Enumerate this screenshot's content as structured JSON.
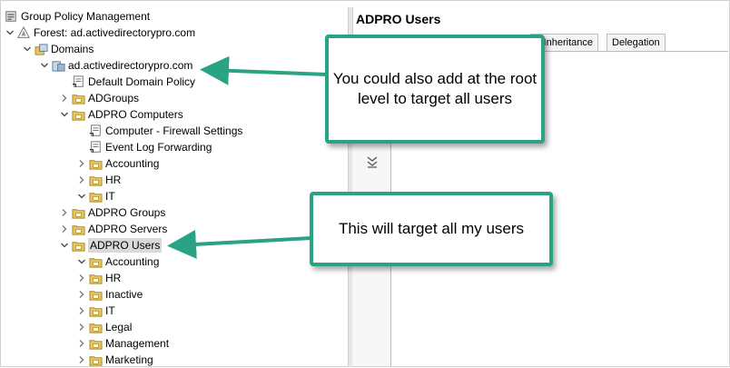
{
  "tree": {
    "items": [
      {
        "label": "Group Policy Management",
        "indent": 0,
        "expander": "none",
        "icon": "gpm-icon",
        "selected": false
      },
      {
        "label": "Forest: ad.activedirectorypro.com",
        "indent": 0,
        "expander": "expanded",
        "icon": "forest-icon",
        "selected": false
      },
      {
        "label": "Domains",
        "indent": 1,
        "expander": "expanded",
        "icon": "domains-icon",
        "selected": false
      },
      {
        "label": "ad.activedirectorypro.com",
        "indent": 2,
        "expander": "expanded",
        "icon": "domain-icon",
        "selected": false
      },
      {
        "label": "Default Domain Policy",
        "indent": 3,
        "expander": "none",
        "icon": "gpo-link-icon",
        "selected": false
      },
      {
        "label": "ADGroups",
        "indent": 3,
        "expander": "collapsed",
        "icon": "ou-folder-icon",
        "selected": false
      },
      {
        "label": "ADPRO Computers",
        "indent": 3,
        "expander": "expanded",
        "icon": "ou-folder-icon",
        "selected": false
      },
      {
        "label": "Computer - Firewall Settings",
        "indent": 4,
        "expander": "none",
        "icon": "gpo-link-icon",
        "selected": false
      },
      {
        "label": "Event Log Forwarding",
        "indent": 4,
        "expander": "none",
        "icon": "gpo-link-icon",
        "selected": false
      },
      {
        "label": "Accounting",
        "indent": 4,
        "expander": "collapsed",
        "icon": "ou-folder-icon",
        "selected": false
      },
      {
        "label": "HR",
        "indent": 4,
        "expander": "collapsed",
        "icon": "ou-folder-icon",
        "selected": false
      },
      {
        "label": "IT",
        "indent": 4,
        "expander": "expanded",
        "icon": "ou-folder-icon",
        "selected": false
      },
      {
        "label": "ADPRO Groups",
        "indent": 3,
        "expander": "collapsed",
        "icon": "ou-folder-icon",
        "selected": false
      },
      {
        "label": "ADPRO Servers",
        "indent": 3,
        "expander": "collapsed",
        "icon": "ou-folder-icon",
        "selected": false
      },
      {
        "label": "ADPRO Users",
        "indent": 3,
        "expander": "expanded",
        "icon": "ou-folder-icon",
        "selected": true
      },
      {
        "label": "Accounting",
        "indent": 4,
        "expander": "expanded",
        "icon": "ou-folder-icon",
        "selected": false
      },
      {
        "label": "HR",
        "indent": 4,
        "expander": "collapsed",
        "icon": "ou-folder-icon",
        "selected": false
      },
      {
        "label": "Inactive",
        "indent": 4,
        "expander": "collapsed",
        "icon": "ou-folder-icon",
        "selected": false
      },
      {
        "label": "IT",
        "indent": 4,
        "expander": "collapsed",
        "icon": "ou-folder-icon",
        "selected": false
      },
      {
        "label": "Legal",
        "indent": 4,
        "expander": "collapsed",
        "icon": "ou-folder-icon",
        "selected": false
      },
      {
        "label": "Management",
        "indent": 4,
        "expander": "collapsed",
        "icon": "ou-folder-icon",
        "selected": false
      },
      {
        "label": "Marketing",
        "indent": 4,
        "expander": "collapsed",
        "icon": "ou-folder-icon",
        "selected": false
      }
    ]
  },
  "details": {
    "title": "ADPRO Users",
    "tabs": [
      "y Inheritance",
      "Delegation"
    ]
  },
  "callouts": {
    "top": "You could also add at the root level to target all users",
    "bottom": "This will target all my users"
  },
  "colors": {
    "callout_border": "#2aa284",
    "arrow": "#2aa284",
    "folder": "#e8c45c",
    "selection": "#d9d9d9"
  }
}
